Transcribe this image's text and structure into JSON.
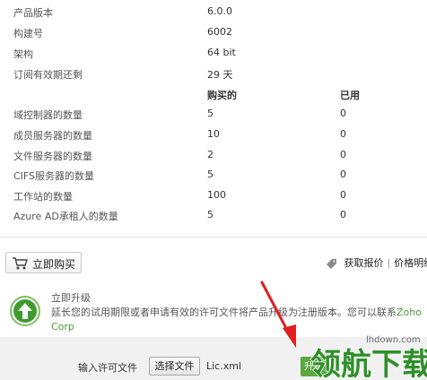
{
  "info_rows": [
    {
      "label": "产品版本",
      "value": "6.0.0"
    },
    {
      "label": "构建号",
      "value": "6002"
    },
    {
      "label": "架构",
      "value": "64 bit"
    },
    {
      "label": "订阅有效期还剩",
      "value": "29 天"
    }
  ],
  "table_header": {
    "purchased": "购买的",
    "used": "已用"
  },
  "table_rows": [
    {
      "label": "域控制器的数量",
      "purchased": "5",
      "used": "0"
    },
    {
      "label": "成员服务器的数量",
      "purchased": "10",
      "used": "0"
    },
    {
      "label": "文件服务器的数量",
      "purchased": "2",
      "used": "0"
    },
    {
      "label": "CIFS服务器的数量",
      "purchased": "5",
      "used": "0"
    },
    {
      "label": "工作站的数量",
      "purchased": "100",
      "used": "0"
    },
    {
      "label": "Azure AD承租人的数量",
      "purchased": "5",
      "used": "0"
    }
  ],
  "buy_button": {
    "label": "立即购买",
    "icon": "cart-icon"
  },
  "quote": {
    "get_quote": "获取报价",
    "separator": "|",
    "price": "价格明细",
    "icon": "tag-icon"
  },
  "upgrade": {
    "title": "立即升级",
    "description": "延长您的试用期限或者申请有效的许可文件将产品升级为注册版本。您可以联系",
    "zoho": "Zoho Corp",
    "icon": "upgrade-arrow-icon"
  },
  "license": {
    "label": "输入许可文件",
    "choose_button": "选择文件",
    "file_name": "Lic.xml",
    "upgrade_button": "升级"
  },
  "watermark": {
    "text": "领航下载",
    "url": "lhdown.com"
  },
  "colors": {
    "accent_green": "#3f9b30",
    "link_green": "#4a9c3a",
    "arrow_red": "#e02020"
  }
}
